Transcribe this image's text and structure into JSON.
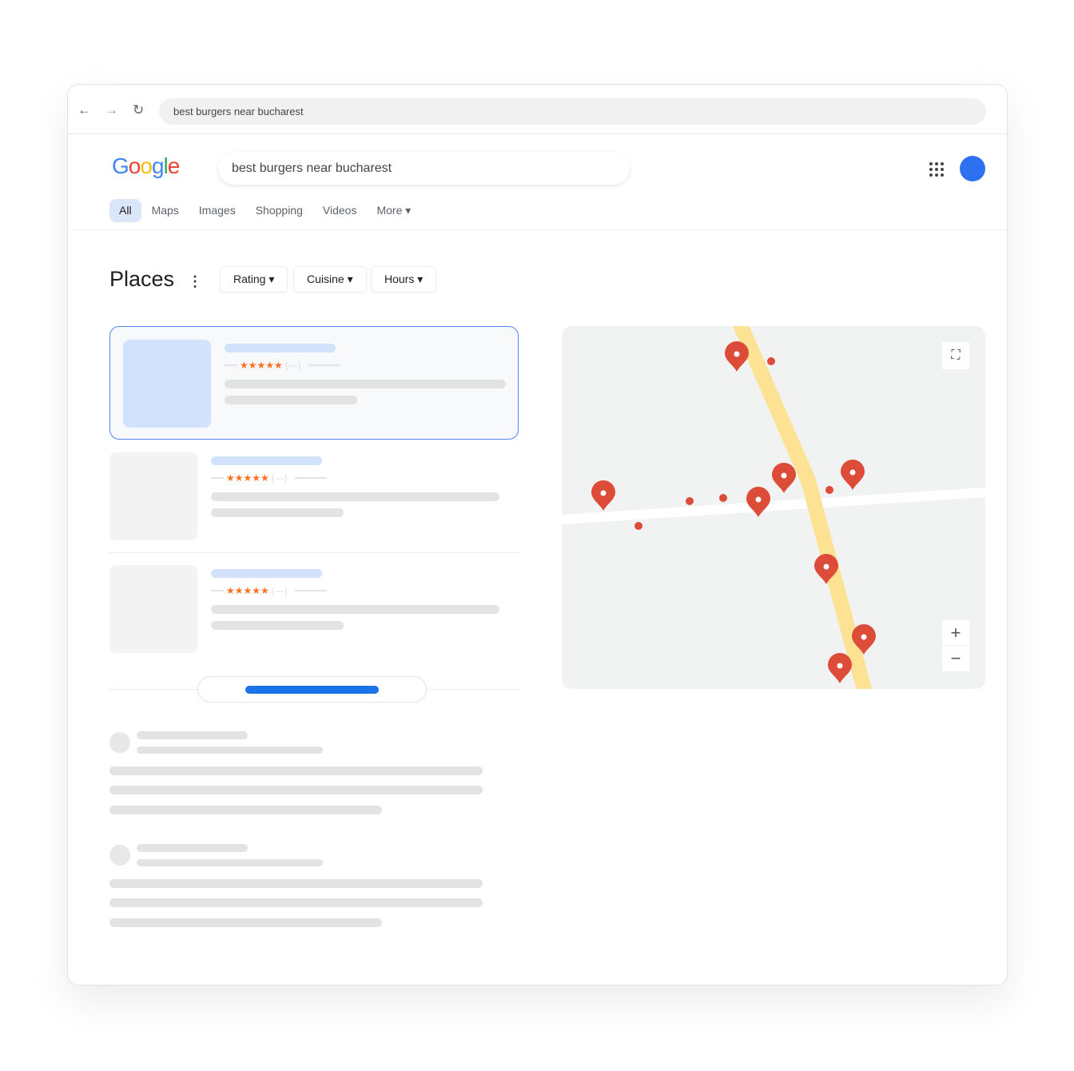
{
  "browser": {
    "back_icon": "←",
    "forward_icon": "→",
    "reload_icon": "↻",
    "url": "best burgers near bucharest"
  },
  "header": {
    "logo": "Google",
    "logo_colors": [
      "#4285f4",
      "#ea4335",
      "#fbbc05",
      "#4285f4",
      "#34a853",
      "#ea4335"
    ],
    "query": "best burgers near bucharest"
  },
  "tabs": [
    {
      "label": "All"
    },
    {
      "label": "Maps"
    },
    {
      "label": "Images"
    },
    {
      "label": "Shopping"
    },
    {
      "label": "Videos"
    },
    {
      "label": "More ▾"
    }
  ],
  "places": {
    "title": "Places",
    "menu_icon": "⋮",
    "filters": [
      {
        "label": "Rating ▾"
      },
      {
        "label": "Cuisine ▾"
      },
      {
        "label": "Hours ▾"
      }
    ],
    "stars": "★★★★★",
    "paren": "(—)"
  },
  "map": {
    "road_color": "#fde293",
    "pin_color": "#dd4b39",
    "fullscreen_icon": "⛶",
    "zoom_in": "+",
    "zoom_out": "−"
  },
  "accent": "#1a73e8"
}
